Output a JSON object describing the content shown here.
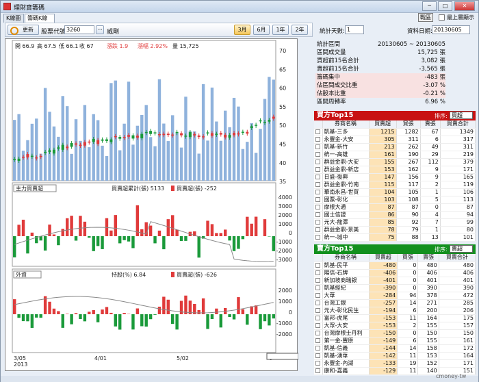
{
  "window": {
    "title": "理財寶籌碼",
    "buttons": [
      "─",
      "□",
      "✕"
    ]
  },
  "tabs": [
    {
      "label": "K線圖"
    },
    {
      "label": "籌碼K線圖"
    }
  ],
  "topright": {
    "ui_label": "戰區",
    "ontop_label": "最上層顯示"
  },
  "toolbar": {
    "refresh_label": "更新",
    "stock_code_label": "股票代號:",
    "stock_code_value": "3260",
    "more_label": "···",
    "stock_name": "威剛",
    "periods": [
      "3月",
      "6月",
      "1年",
      "2年"
    ],
    "selected_period": "3月"
  },
  "price_header": {
    "open": "開 66.9",
    "high": "高 67.5",
    "low": "低 66.1",
    "close": "收 67",
    "change": "漲跌 1.9",
    "pct": "漲幅 2.92%",
    "vol": "量 15,725"
  },
  "price_axis": [
    "70",
    "65",
    "60",
    "55",
    "50",
    "45",
    "40",
    "35"
  ],
  "panel2": {
    "select": "主力買賣超",
    "legend_line": "買賣超累計(張) 5133",
    "legend_bar": "買賣超(張) -252",
    "axis": [
      "4000",
      "3000",
      "2000",
      "1000",
      "0",
      "-1000",
      "-2000",
      "-3000"
    ]
  },
  "panel3": {
    "select": "外資",
    "legend_line": "持股(%) 6.84",
    "legend_bar": "買賣超(張) -626",
    "axis": [
      "2000",
      "1000",
      "0",
      "-1000",
      "-2000"
    ]
  },
  "xaxis": {
    "labels": [
      "3/05",
      "4/01",
      "5/02",
      "6"
    ],
    "year": "2013"
  },
  "stats": {
    "days_label": "統計天數:",
    "days_value": "1",
    "date_label": "資料日期:",
    "date_value": "20130605",
    "rows": [
      {
        "label": "統計區間",
        "value": "20130605 ~ 20130605",
        "pink": false
      },
      {
        "label": "區間成交量",
        "value": "15,725 張",
        "pink": false
      },
      {
        "label": "買超前15名合計",
        "value": "3,082 張",
        "pink": false
      },
      {
        "label": "賣超前15名合計",
        "value": "-3,565 張",
        "pink": false
      },
      {
        "label": "籌碼集中",
        "value": "-483 張",
        "pink": true
      },
      {
        "label": "佔區間成交比重",
        "value": "-3.07 %",
        "pink": true
      },
      {
        "label": "佔股本比重",
        "value": "-0.21 %",
        "pink": true
      },
      {
        "label": "區間周轉率",
        "value": "6.96 %",
        "pink": false
      }
    ]
  },
  "buy_top": {
    "title": "買方Top15",
    "sort_label": "排序:",
    "sort_value": "買超",
    "columns": [
      "券商名稱",
      "買賣超",
      "買張",
      "賣張",
      "買賣合計"
    ],
    "rows": [
      [
        "凱基-三多",
        "1215",
        "1282",
        "67",
        "1349"
      ],
      [
        "永豐金-大安",
        "305",
        "311",
        "6",
        "317"
      ],
      [
        "凱基-新竹",
        "213",
        "262",
        "49",
        "311"
      ],
      [
        "統一-高雄",
        "161",
        "190",
        "29",
        "219"
      ],
      [
        "群益金鼎-大安",
        "155",
        "267",
        "112",
        "379"
      ],
      [
        "群益金鼎-新店",
        "153",
        "162",
        "9",
        "171"
      ],
      [
        "日盛-復興",
        "147",
        "156",
        "9",
        "165"
      ],
      [
        "群益金鼎-竹南",
        "115",
        "117",
        "2",
        "119"
      ],
      [
        "華南永昌-世貿",
        "104",
        "105",
        "1",
        "106"
      ],
      [
        "國票-彰化",
        "103",
        "108",
        "5",
        "113"
      ],
      [
        "摩根大通",
        "87",
        "87",
        "0",
        "87"
      ],
      [
        "國士信證",
        "86",
        "90",
        "4",
        "94"
      ],
      [
        "元大-龍潭",
        "85",
        "92",
        "7",
        "99"
      ],
      [
        "群益金鼎-景美",
        "78",
        "79",
        "1",
        "80"
      ],
      [
        "統一-城中",
        "75",
        "88",
        "13",
        "101"
      ]
    ]
  },
  "sell_top": {
    "title": "賣方Top15",
    "sort_label": "排序:",
    "sort_value": "賣超",
    "columns": [
      "券商名稱",
      "買賣超",
      "買張",
      "賣張",
      "買賣合計"
    ],
    "rows": [
      [
        "凱基-民平",
        "-480",
        "0",
        "480",
        "480"
      ],
      [
        "陽信-石牌",
        "-406",
        "0",
        "406",
        "406"
      ],
      [
        "新加坡商瑞銀",
        "-401",
        "0",
        "401",
        "401"
      ],
      [
        "凱基經紀",
        "-390",
        "0",
        "390",
        "390"
      ],
      [
        "大華",
        "-284",
        "94",
        "378",
        "472"
      ],
      [
        "台灣工銀",
        "-257",
        "14",
        "271",
        "285"
      ],
      [
        "元大-彰化民生",
        "-194",
        "6",
        "200",
        "206"
      ],
      [
        "富邦-虎尾",
        "-153",
        "11",
        "164",
        "175"
      ],
      [
        "大眾-大安",
        "-153",
        "2",
        "155",
        "157"
      ],
      [
        "台灣摩根士丹利",
        "-150",
        "0",
        "150",
        "150"
      ],
      [
        "第一金-豐原",
        "-149",
        "6",
        "155",
        "161"
      ],
      [
        "凱基-信義",
        "-144",
        "14",
        "158",
        "172"
      ],
      [
        "凱基-湧華",
        "-142",
        "11",
        "153",
        "164"
      ],
      [
        "永豐金-內湖",
        "-133",
        "19",
        "152",
        "171"
      ],
      [
        "康和-嘉義",
        "-129",
        "11",
        "140",
        "151"
      ]
    ]
  },
  "colors": {
    "up": "#e03a3a",
    "down": "#1a9a3a",
    "volume": "#8fb2dc",
    "buy_header": "#c81212",
    "sell_header": "#12901e"
  },
  "watermark": "cmoney-tw"
}
